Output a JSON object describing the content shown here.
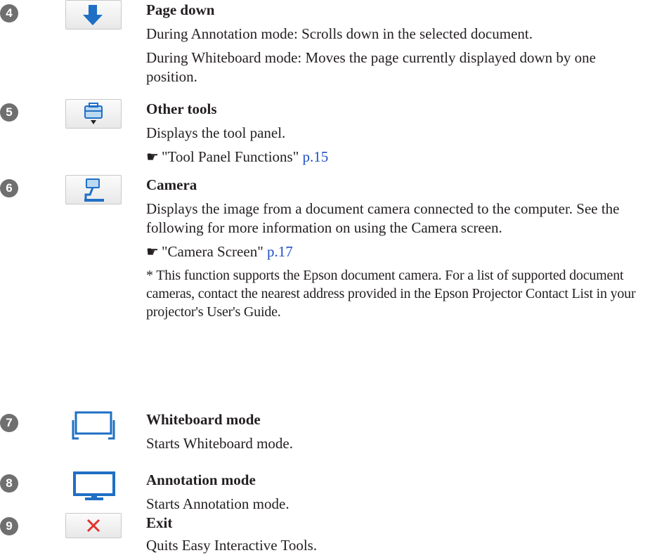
{
  "items": [
    {
      "number": "4",
      "icon": "arrow-down-icon",
      "title": "Page down",
      "lines": [
        "During Annotation mode: Scrolls down in the selected document.",
        "During Whiteboard mode: Moves the page currently displayed down by one position."
      ]
    },
    {
      "number": "5",
      "icon": "toolbox-icon",
      "title": "Other tools",
      "lines": [
        "Displays the tool panel."
      ],
      "ref": {
        "pointer": "☛",
        "text": "\"Tool Panel Functions\"",
        "page": "p.15"
      }
    },
    {
      "number": "6",
      "icon": "document-camera-icon",
      "title": "Camera",
      "lines": [
        "Displays the image from a document camera connected to the computer. See the following for more information on using the Camera screen."
      ],
      "ref": {
        "pointer": "☛",
        "text": "\"Camera Screen\"",
        "page": "p.17"
      },
      "note": "* This function supports the Epson document camera. For a list of supported document cameras, contact the nearest address provided in the Epson Projector Contact List in your projector's User's Guide."
    },
    {
      "number": "7",
      "icon": "whiteboard-icon",
      "title": "Whiteboard mode",
      "lines": [
        "Starts Whiteboard mode."
      ]
    },
    {
      "number": "8",
      "icon": "monitor-icon",
      "title": "Annotation mode",
      "lines": [
        "Starts Annotation mode."
      ]
    },
    {
      "number": "9",
      "icon": "close-icon",
      "title": "Exit",
      "lines": [
        "Quits Easy Interactive Tools."
      ]
    }
  ],
  "colors": {
    "number_badge": "#6f6f6f",
    "link": "#1f4fc4",
    "icon_blue": "#1f6fc5"
  }
}
